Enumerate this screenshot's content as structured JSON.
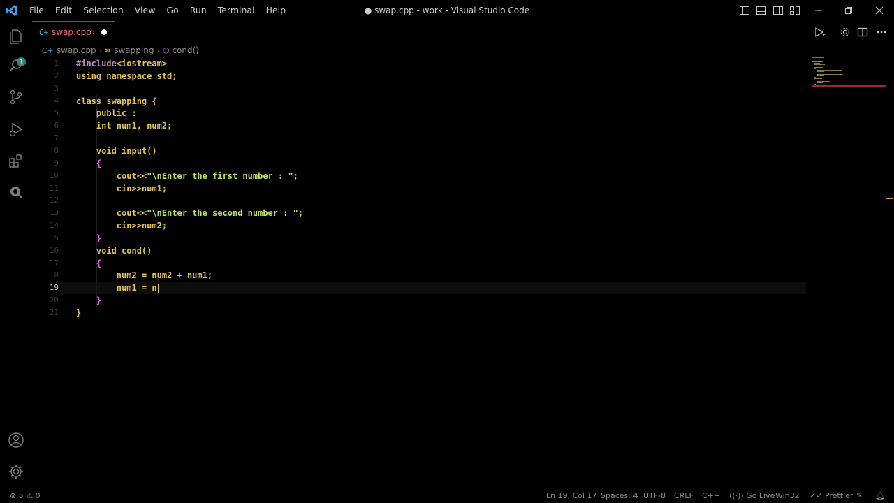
{
  "window": {
    "title": "● swap.cpp - work - Visual Studio Code"
  },
  "menu": [
    "File",
    "Edit",
    "Selection",
    "View",
    "Go",
    "Run",
    "Terminal",
    "Help"
  ],
  "activity": {
    "explorer_badge": "1",
    "icons": [
      "files-icon",
      "search-icon",
      "source-control-icon",
      "run-debug-icon",
      "extensions-icon",
      "remote-icon"
    ]
  },
  "tab": {
    "icon": "C+",
    "label": "swap.cpp",
    "problems": "5"
  },
  "breadcrumb": {
    "file": "swap.cpp",
    "class": "swapping",
    "method": "cond()"
  },
  "code": {
    "current_line": 19,
    "lines": [
      {
        "n": "1",
        "parts": [
          [
            "c-pre",
            "#include"
          ],
          [
            "c-kw",
            "<iostream>"
          ]
        ]
      },
      {
        "n": "2",
        "parts": [
          [
            "c-kw",
            "using namespace std;"
          ]
        ]
      },
      {
        "n": "3",
        "parts": []
      },
      {
        "n": "4",
        "parts": [
          [
            "c-kw",
            "class swapping "
          ],
          [
            "c-brace",
            "{"
          ]
        ]
      },
      {
        "n": "5",
        "parts": [
          [
            "c-kw",
            "    public :"
          ]
        ]
      },
      {
        "n": "6",
        "parts": [
          [
            "c-kw",
            "    int num1, num2;"
          ]
        ]
      },
      {
        "n": "7",
        "parts": []
      },
      {
        "n": "8",
        "parts": [
          [
            "c-kw",
            "    void input()"
          ]
        ]
      },
      {
        "n": "9",
        "parts": [
          [
            "c-brace2",
            "    {"
          ]
        ]
      },
      {
        "n": "10",
        "parts": [
          [
            "c-kw",
            "        cout<<"
          ],
          [
            "c-str",
            "\"\\nEnter the first number : \""
          ],
          [
            "c-kw",
            ";"
          ]
        ]
      },
      {
        "n": "11",
        "parts": [
          [
            "c-kw",
            "        cin>>num1;"
          ]
        ]
      },
      {
        "n": "12",
        "parts": []
      },
      {
        "n": "13",
        "parts": [
          [
            "c-kw",
            "        cout<<"
          ],
          [
            "c-str",
            "\"\\nEnter the second number : \""
          ],
          [
            "c-kw",
            ";"
          ]
        ]
      },
      {
        "n": "14",
        "parts": [
          [
            "c-kw",
            "        cin>>num2;"
          ]
        ]
      },
      {
        "n": "15",
        "parts": [
          [
            "c-brace2",
            "    }"
          ]
        ]
      },
      {
        "n": "16",
        "parts": [
          [
            "c-kw",
            "    void cond()"
          ]
        ]
      },
      {
        "n": "17",
        "parts": [
          [
            "c-brace2",
            "    {"
          ]
        ]
      },
      {
        "n": "18",
        "parts": [
          [
            "c-kw",
            "        num2 = num2 + num1;"
          ]
        ]
      },
      {
        "n": "19",
        "parts": [
          [
            "c-kw",
            "        num1 = n"
          ]
        ]
      },
      {
        "n": "20",
        "parts": [
          [
            "c-brace2",
            "    }"
          ]
        ]
      },
      {
        "n": "21",
        "parts": [
          [
            "c-brace",
            "}"
          ]
        ]
      }
    ]
  },
  "status": {
    "errors": "5",
    "warnings": "0",
    "position": "Ln 19, Col 17",
    "spaces": "Spaces: 4",
    "encoding": "UTF-8",
    "eol": "CRLF",
    "language": "C++",
    "golive": "Go Live",
    "platform": "Win32",
    "prettier": "Prettier"
  },
  "colors": {
    "accent": "#0078d4",
    "error": "#e86f6f",
    "keyword": "#e2c35d",
    "string": "#b9e36a"
  }
}
